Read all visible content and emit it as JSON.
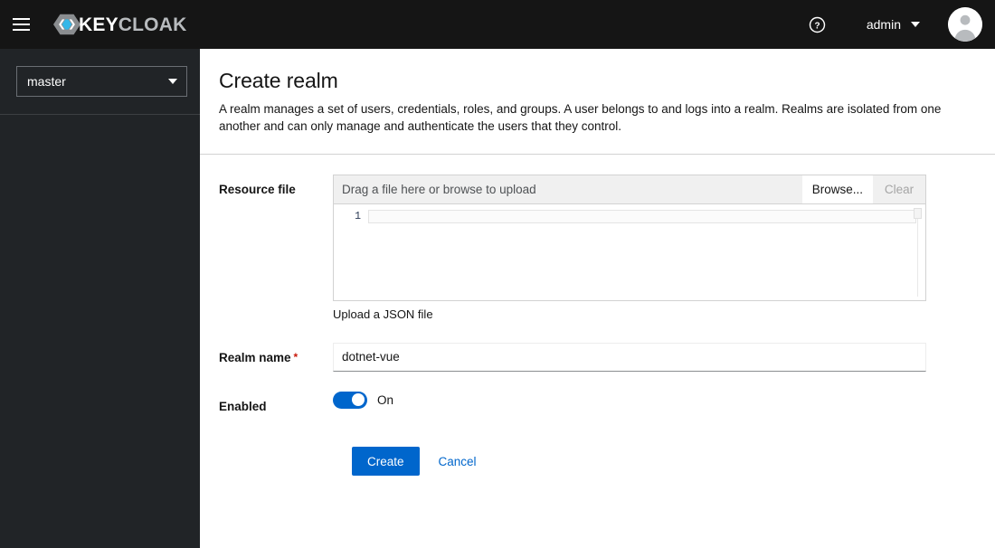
{
  "masthead": {
    "menu_toggle_name": "Global navigation",
    "brand_primary": "KEY",
    "brand_secondary": "CLOAK",
    "help_icon": "question-circle-icon",
    "user_name": "admin",
    "caret_icon": "chevron-down-icon",
    "avatar_icon": "user-avatar-icon"
  },
  "sidebar": {
    "realm_selected": "master",
    "realm_caret_icon": "caret-down-icon"
  },
  "page": {
    "title": "Create realm",
    "description": "A realm manages a set of users, credentials, roles, and groups. A user belongs to and logs into a realm. Realms are isolated from one another and can only manage and authenticate the users that they control."
  },
  "form": {
    "resource_file": {
      "label": "Resource file",
      "placeholder": "Drag a file here or browse to upload",
      "browse_label": "Browse...",
      "clear_label": "Clear",
      "line_number": "1",
      "code_value": "",
      "helper_text": "Upload a JSON file"
    },
    "realm_name": {
      "label": "Realm name",
      "required_marker": "*",
      "value": "dotnet-vue",
      "placeholder": ""
    },
    "enabled": {
      "label": "Enabled",
      "state_label": "On",
      "state": true
    },
    "actions": {
      "submit_label": "Create",
      "cancel_label": "Cancel"
    }
  },
  "colors": {
    "accent": "#0066cc",
    "masthead_bg": "#151515",
    "sidebar_bg": "#212427",
    "required": "#c9190b",
    "brand_blue": "#35b7e8"
  }
}
